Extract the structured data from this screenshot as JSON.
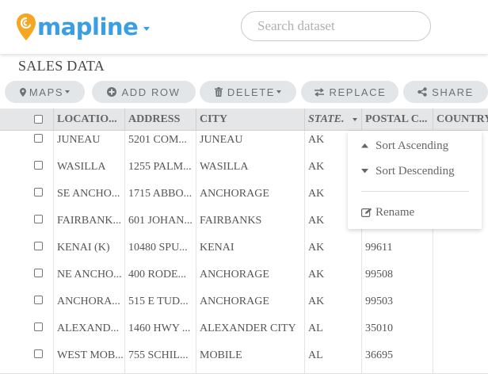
{
  "app": {
    "logo_text": "mapline"
  },
  "search": {
    "placeholder": "Search dataset"
  },
  "dataset": {
    "title": "SALES DATA"
  },
  "toolbar": {
    "maps_label": "MAPS",
    "add_row_label": "ADD ROW",
    "delete_label": "DELETE",
    "replace_label": "REPLACE",
    "share_label": "SHARE"
  },
  "table": {
    "columns": [
      "LOCATIO...",
      "ADDRESS",
      "CITY",
      "STATE",
      "POSTAL C...",
      "COUNTRY"
    ],
    "rows": [
      [
        "JUNEAU",
        "5201 COM...",
        "JUNEAU",
        "AK",
        ""
      ],
      [
        "WASILLA",
        "1255 PALM...",
        "WASILLA",
        "AK",
        ""
      ],
      [
        "SE ANCHO...",
        "1715 ABBO...",
        "ANCHORAGE",
        "AK",
        ""
      ],
      [
        "FAIRBANK...",
        "601 JOHAN...",
        "FAIRBANKS",
        "AK",
        ""
      ],
      [
        "KENAI (K)",
        "10480 SPU...",
        "KENAI",
        "AK",
        "99611"
      ],
      [
        "NE ANCHO...",
        "400 RODE...",
        "ANCHORAGE",
        "AK",
        "99508"
      ],
      [
        "ANCHORA...",
        "515 E TUD...",
        "ANCHORAGE",
        "AK",
        "99503"
      ],
      [
        "ALEXAND...",
        "1460 HWY ...",
        "ALEXANDER CITY",
        "AL",
        "35010"
      ],
      [
        "WEST MOB...",
        "755 SCHIL...",
        "MOBILE",
        "AL",
        "36695"
      ]
    ]
  },
  "column_menu": {
    "sort_ascending": "Sort Ascending",
    "sort_descending": "Sort Descending",
    "rename": "Rename"
  },
  "colors": {
    "brand": "#3a9fe0",
    "logo_pin": "#f5a623",
    "button_bg": "#e3e6e8",
    "header_bg": "#e4e6e8"
  },
  "icons": {
    "maps": "map-marker-icon",
    "add_row": "plus-circle-icon",
    "delete": "trash-icon",
    "replace": "swap-arrows-icon",
    "share": "share-icon",
    "sort_asc": "caret-up-icon",
    "sort_desc": "caret-down-icon",
    "rename": "edit-icon"
  }
}
